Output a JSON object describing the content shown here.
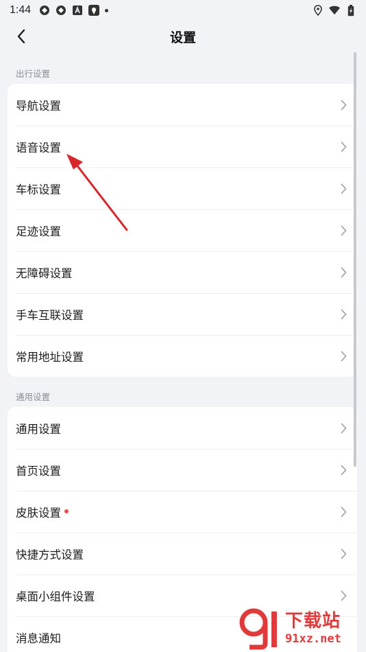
{
  "status_bar": {
    "time": "1:44"
  },
  "header": {
    "title": "设置"
  },
  "sections": [
    {
      "label": "出行设置",
      "items": [
        {
          "label": "导航设置"
        },
        {
          "label": "语音设置"
        },
        {
          "label": "车标设置"
        },
        {
          "label": "足迹设置"
        },
        {
          "label": "无障碍设置"
        },
        {
          "label": "手车互联设置"
        },
        {
          "label": "常用地址设置"
        }
      ]
    },
    {
      "label": "通用设置",
      "items": [
        {
          "label": "通用设置"
        },
        {
          "label": "首页设置"
        },
        {
          "label": "皮肤设置",
          "badge_dot": true
        },
        {
          "label": "快捷方式设置"
        },
        {
          "label": "桌面小组件设置"
        },
        {
          "label": "消息通知"
        }
      ]
    }
  ],
  "watermark": {
    "top_text": "下载站",
    "bottom_text": "91xz.net"
  },
  "colors": {
    "background": "#f2f3f7",
    "card": "#ffffff",
    "accent_red": "#e23a3a",
    "badge_dot": "#f04a4a",
    "annotation_arrow": "#d8262a"
  }
}
